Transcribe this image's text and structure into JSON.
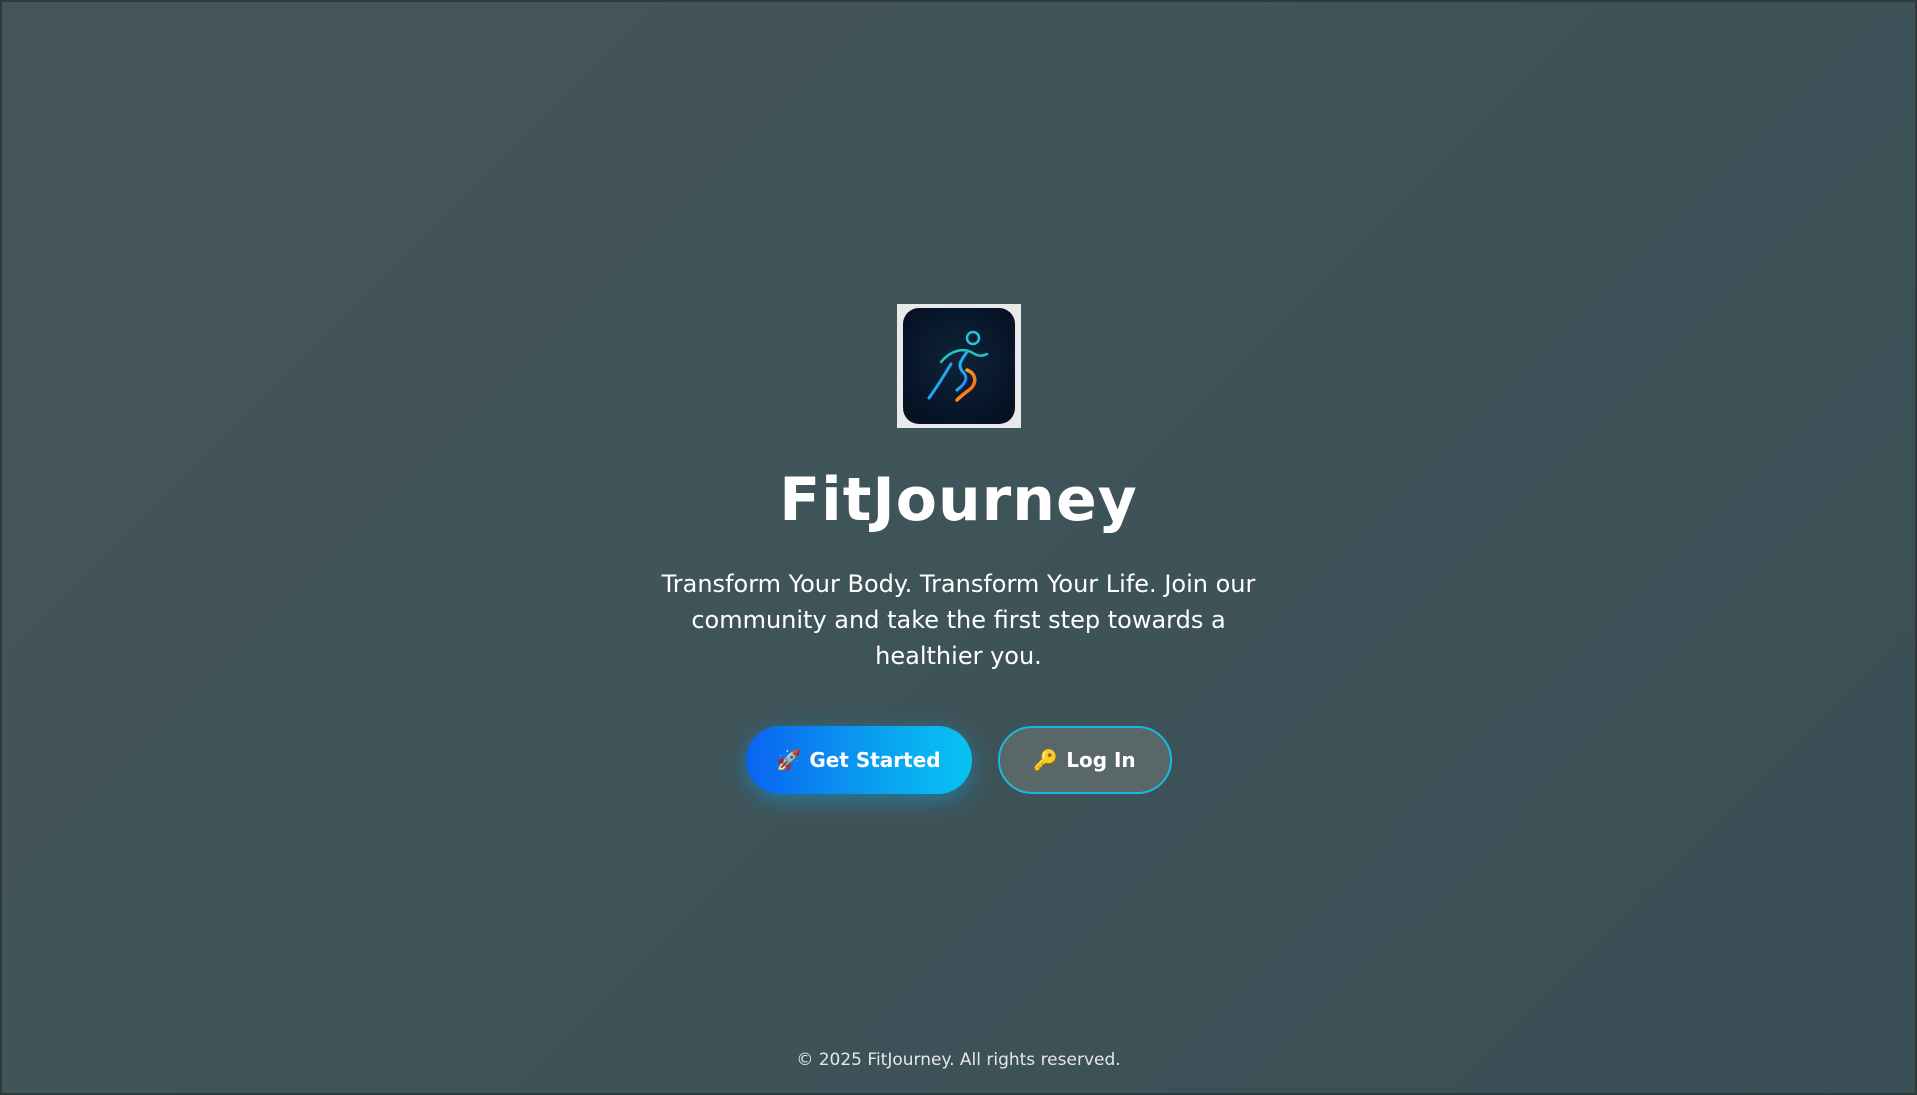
{
  "app": {
    "logo_icon": "running-person-icon",
    "title": "FitJourney",
    "tagline": "Transform Your Body. Transform Your Life. Join our community and take the first step towards a healthier you."
  },
  "actions": {
    "get_started": {
      "icon": "🚀",
      "label": "Get Started",
      "icon_name": "rocket-icon"
    },
    "log_in": {
      "icon": "🔑",
      "label": "Log In",
      "icon_name": "key-icon"
    }
  },
  "footer": {
    "copyright": "© 2025 FitJourney. All rights reserved."
  },
  "colors": {
    "background": "#3f5459",
    "primary_button_start": "#0a63f2",
    "primary_button_end": "#08c3f3",
    "secondary_border": "#18b8ea"
  }
}
